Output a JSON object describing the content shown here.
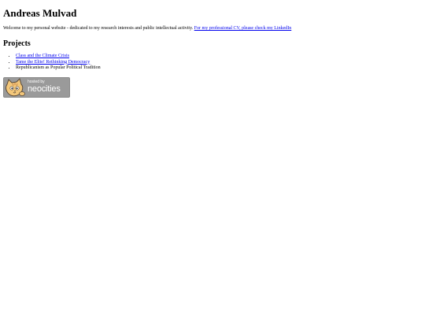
{
  "header": {
    "title": "Andreas Mulvad"
  },
  "intro": {
    "text": "Welcome to my personal website - dedicated to my research interests and public intellectual activity. ",
    "link_text": "For my professional CV, please check my LinkedIn"
  },
  "projects": {
    "heading": "Projects",
    "items": [
      {
        "label": "Class and the Climate Crisis",
        "is_link": true
      },
      {
        "label": "Tame the Elite! Rethinking Democracy",
        "is_link": true
      },
      {
        "label": "Republicanism as Popular Political Tradition",
        "is_link": false
      }
    ]
  },
  "badge": {
    "small_text": "hosted by",
    "brand": "neocities",
    "icon": "neocities-cat-icon",
    "colors": {
      "background": "#9a9a9a",
      "cat": "#f3c77a",
      "outline": "#5a4a3a"
    }
  },
  "colors": {
    "link": "#0000ee",
    "text": "#000000",
    "background": "#ffffff"
  }
}
